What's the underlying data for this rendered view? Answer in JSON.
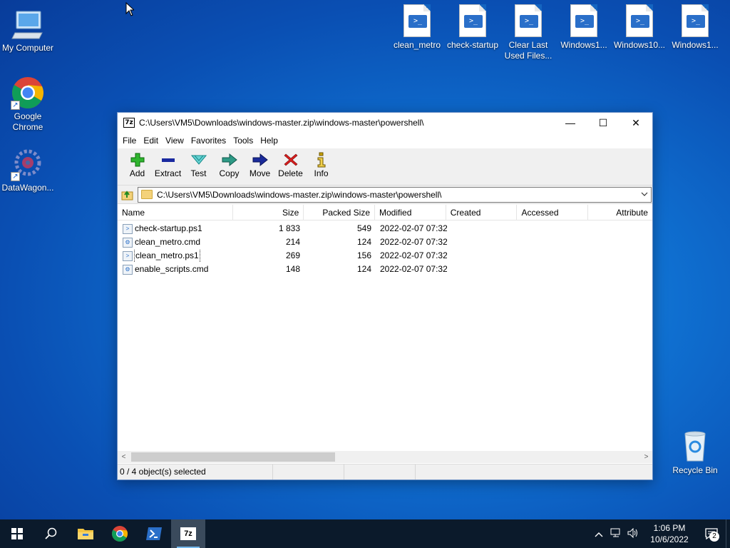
{
  "desktop": {
    "left_icons": [
      {
        "label": "My Computer",
        "icon": "my-computer-icon"
      },
      {
        "label": "Google Chrome",
        "icon": "chrome-icon"
      },
      {
        "label": "DataWagon...",
        "icon": "datawagon-icon"
      }
    ],
    "top_icons": [
      {
        "label": "clean_metro",
        "icon": "powershell-script-icon"
      },
      {
        "label": "check-startup",
        "icon": "powershell-script-icon"
      },
      {
        "label": "Clear Last Used Files...",
        "icon": "powershell-script-icon"
      },
      {
        "label": "Windows1...",
        "icon": "powershell-script-icon"
      },
      {
        "label": "Windows10...",
        "icon": "powershell-script-icon"
      },
      {
        "label": "Windows1...",
        "icon": "powershell-script-icon"
      }
    ],
    "recycle_bin": {
      "label": "Recycle Bin",
      "icon": "recycle-bin-icon"
    }
  },
  "window": {
    "app_icon_text": "7z",
    "title": "C:\\Users\\VM5\\Downloads\\windows-master.zip\\windows-master\\powershell\\",
    "controls": {
      "minimize": "—",
      "maximize": "☐",
      "close": "✕"
    },
    "menu": [
      "File",
      "Edit",
      "View",
      "Favorites",
      "Tools",
      "Help"
    ],
    "toolbar": [
      {
        "label": "Add",
        "icon": "add-icon"
      },
      {
        "label": "Extract",
        "icon": "extract-icon"
      },
      {
        "label": "Test",
        "icon": "test-icon"
      },
      {
        "label": "Copy",
        "icon": "copy-icon"
      },
      {
        "label": "Move",
        "icon": "move-icon"
      },
      {
        "label": "Delete",
        "icon": "delete-icon"
      },
      {
        "label": "Info",
        "icon": "info-icon"
      }
    ],
    "address": "C:\\Users\\VM5\\Downloads\\windows-master.zip\\windows-master\\powershell\\",
    "columns": [
      "Name",
      "Size",
      "Packed Size",
      "Modified",
      "Created",
      "Accessed",
      "Attribute"
    ],
    "files": [
      {
        "name": "check-startup.ps1",
        "size": "1 833",
        "packed": "549",
        "modified": "2022-02-07 07:32",
        "created": "",
        "accessed": "",
        "attr": ""
      },
      {
        "name": "clean_metro.cmd",
        "size": "214",
        "packed": "124",
        "modified": "2022-02-07 07:32",
        "created": "",
        "accessed": "",
        "attr": ""
      },
      {
        "name": "clean_metro.ps1",
        "size": "269",
        "packed": "156",
        "modified": "2022-02-07 07:32",
        "created": "",
        "accessed": "",
        "attr": ""
      },
      {
        "name": "enable_scripts.cmd",
        "size": "148",
        "packed": "124",
        "modified": "2022-02-07 07:32",
        "created": "",
        "accessed": "",
        "attr": ""
      }
    ],
    "status": {
      "selection": "0 / 4 object(s) selected",
      "cell2": "",
      "cell3": "",
      "cell4": ""
    },
    "scroll_left": "<",
    "scroll_right": ">"
  },
  "taskbar": {
    "apps": [
      {
        "name": "start",
        "icon": "windows-start-icon"
      },
      {
        "name": "search",
        "icon": "search-icon"
      },
      {
        "name": "file-explorer",
        "icon": "folder-icon"
      },
      {
        "name": "chrome",
        "icon": "chrome-icon"
      },
      {
        "name": "powershell",
        "icon": "powershell-icon"
      },
      {
        "name": "7zip",
        "icon": "7zip-icon",
        "label": "7z"
      }
    ],
    "tray": {
      "chevron": "^",
      "time": "1:06 PM",
      "date": "10/6/2022",
      "notification_count": "2"
    }
  },
  "colors": {
    "accent": "#0078d7",
    "taskbar": "#0b1a2b",
    "add_green": "#2fb52f",
    "delete_red": "#d81e1e",
    "move_navy": "#1a2a9a"
  }
}
